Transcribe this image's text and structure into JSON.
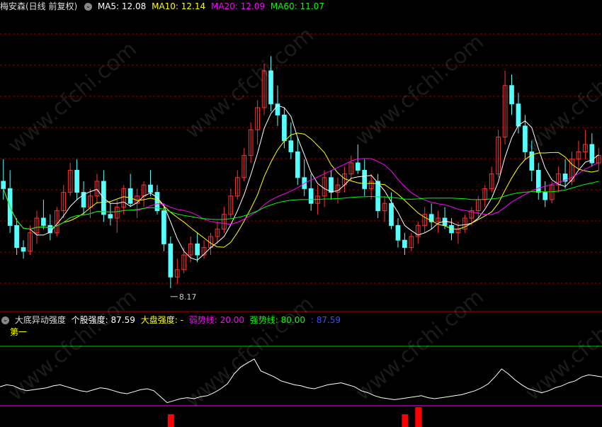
{
  "header": {
    "stock_title": "梅安森(日线 前复权)",
    "ma5": "MA5: 12.08",
    "ma10": "MA10: 12.14",
    "ma20": "MA20: 12.09",
    "ma60": "MA60: 11.07"
  },
  "indicator": {
    "name": "大底异动强度",
    "stock_strength": "个股强度: 87.59",
    "market_strength": "大盘强度: -",
    "weak_line": "弱势线: 20.00",
    "strong_line": "强势线: 80.00",
    "extra": ": 87.59",
    "first_label": "第一"
  },
  "watermark": "www.cfchi.com",
  "colors": {
    "up": "#ff3232",
    "down": "#54ffff",
    "ma5": "#ffffff",
    "ma10": "#ffff00",
    "ma20": "#ff00ff",
    "ma60": "#00ff00",
    "grid": "#8b0000",
    "weak": "#ff00ff",
    "strong": "#00c800",
    "osc": "#ffffff",
    "bar": "#ff0000"
  },
  "chart_data": {
    "type": "candlestick",
    "low_label": "8.17",
    "y_range": [
      7.5,
      15.5
    ],
    "candles_note": "daily OHLC approx",
    "ohlc": [
      [
        11.0,
        11.6,
        10.5,
        10.8
      ],
      [
        10.8,
        11.3,
        9.6,
        9.8
      ],
      [
        9.8,
        10.0,
        9.0,
        9.2
      ],
      [
        9.2,
        9.4,
        8.9,
        9.1
      ],
      [
        9.1,
        9.8,
        9.0,
        9.6
      ],
      [
        9.6,
        10.2,
        9.3,
        10.0
      ],
      [
        10.0,
        10.5,
        9.7,
        9.8
      ],
      [
        9.8,
        10.1,
        9.4,
        9.6
      ],
      [
        9.6,
        10.3,
        9.5,
        10.2
      ],
      [
        10.2,
        10.9,
        10.0,
        10.7
      ],
      [
        10.7,
        11.5,
        10.6,
        11.3
      ],
      [
        11.3,
        11.6,
        10.5,
        10.7
      ],
      [
        10.7,
        11.0,
        10.1,
        10.3
      ],
      [
        10.3,
        10.8,
        10.0,
        10.6
      ],
      [
        10.6,
        11.2,
        10.4,
        11.0
      ],
      [
        11.0,
        11.3,
        9.9,
        10.1
      ],
      [
        10.1,
        10.4,
        9.8,
        10.0
      ],
      [
        10.0,
        10.5,
        9.6,
        10.3
      ],
      [
        10.3,
        10.9,
        10.1,
        10.8
      ],
      [
        10.8,
        11.2,
        10.3,
        10.4
      ],
      [
        10.4,
        10.8,
        10.0,
        10.6
      ],
      [
        10.6,
        11.0,
        10.3,
        10.9
      ],
      [
        10.9,
        11.3,
        10.6,
        10.7
      ],
      [
        10.7,
        10.9,
        10.1,
        10.2
      ],
      [
        10.2,
        10.4,
        9.1,
        9.3
      ],
      [
        9.3,
        9.5,
        8.1,
        8.4
      ],
      [
        8.4,
        8.9,
        8.2,
        8.6
      ],
      [
        8.6,
        9.2,
        8.5,
        9.0
      ],
      [
        9.0,
        9.5,
        8.8,
        9.3
      ],
      [
        9.3,
        9.6,
        8.8,
        9.0
      ],
      [
        9.0,
        9.4,
        8.9,
        9.2
      ],
      [
        9.2,
        9.6,
        9.0,
        9.5
      ],
      [
        9.5,
        9.9,
        9.3,
        9.7
      ],
      [
        9.7,
        10.3,
        9.6,
        10.1
      ],
      [
        10.1,
        10.8,
        10.0,
        10.6
      ],
      [
        10.6,
        11.3,
        10.5,
        11.1
      ],
      [
        11.1,
        11.9,
        11.0,
        11.7
      ],
      [
        11.7,
        12.6,
        11.5,
        12.4
      ],
      [
        12.4,
        13.2,
        12.0,
        13.0
      ],
      [
        13.0,
        14.2,
        12.8,
        14.0
      ],
      [
        14.0,
        14.4,
        12.9,
        13.1
      ],
      [
        13.1,
        13.6,
        12.5,
        12.8
      ],
      [
        12.8,
        13.0,
        11.9,
        12.1
      ],
      [
        12.1,
        12.6,
        11.6,
        11.8
      ],
      [
        11.8,
        12.2,
        10.9,
        11.1
      ],
      [
        11.1,
        11.6,
        10.6,
        10.8
      ],
      [
        10.8,
        11.2,
        10.2,
        10.4
      ],
      [
        10.4,
        10.9,
        10.1,
        10.6
      ],
      [
        10.6,
        11.3,
        10.3,
        11.1
      ],
      [
        11.1,
        11.3,
        10.5,
        10.7
      ],
      [
        10.7,
        11.1,
        10.4,
        10.9
      ],
      [
        10.9,
        11.4,
        10.7,
        11.2
      ],
      [
        11.2,
        11.7,
        11.0,
        11.5
      ],
      [
        11.5,
        12.0,
        11.2,
        11.3
      ],
      [
        11.3,
        11.6,
        10.6,
        10.8
      ],
      [
        10.8,
        11.2,
        10.5,
        11.0
      ],
      [
        11.0,
        11.2,
        10.0,
        10.2
      ],
      [
        10.2,
        10.6,
        9.9,
        10.4
      ],
      [
        10.4,
        10.7,
        9.7,
        9.8
      ],
      [
        9.8,
        10.0,
        9.2,
        9.4
      ],
      [
        9.4,
        9.6,
        9.0,
        9.2
      ],
      [
        9.2,
        9.6,
        9.1,
        9.5
      ],
      [
        9.5,
        9.9,
        9.3,
        9.8
      ],
      [
        9.8,
        10.3,
        9.6,
        10.1
      ],
      [
        10.1,
        10.4,
        9.7,
        9.9
      ],
      [
        9.9,
        10.2,
        9.6,
        10.0
      ],
      [
        10.0,
        10.3,
        9.7,
        9.8
      ],
      [
        9.8,
        10.0,
        9.4,
        9.6
      ],
      [
        9.6,
        9.9,
        9.3,
        9.7
      ],
      [
        9.7,
        10.1,
        9.6,
        10.0
      ],
      [
        10.0,
        10.3,
        9.8,
        10.2
      ],
      [
        10.2,
        10.6,
        10.0,
        10.5
      ],
      [
        10.5,
        10.9,
        10.3,
        10.8
      ],
      [
        10.8,
        11.4,
        10.7,
        11.2
      ],
      [
        11.2,
        12.4,
        11.1,
        12.2
      ],
      [
        12.2,
        14.0,
        12.0,
        13.6
      ],
      [
        13.6,
        13.9,
        12.8,
        13.1
      ],
      [
        13.1,
        13.4,
        12.3,
        12.5
      ],
      [
        12.5,
        12.8,
        11.6,
        11.8
      ],
      [
        11.8,
        12.1,
        11.0,
        11.3
      ],
      [
        11.3,
        11.5,
        10.5,
        10.7
      ],
      [
        10.7,
        11.0,
        10.3,
        10.5
      ],
      [
        10.5,
        11.0,
        10.4,
        10.9
      ],
      [
        10.9,
        11.4,
        10.7,
        11.2
      ],
      [
        11.2,
        11.6,
        10.8,
        11.0
      ],
      [
        11.0,
        11.8,
        10.9,
        11.6
      ],
      [
        11.6,
        12.1,
        11.3,
        11.8
      ],
      [
        11.8,
        12.4,
        11.6,
        12.0
      ],
      [
        12.0,
        12.3,
        11.4,
        11.5
      ],
      [
        11.5,
        11.9,
        11.3,
        11.7
      ]
    ],
    "oscillator": [
      42,
      44,
      43,
      40,
      38,
      39,
      40,
      41,
      43,
      44,
      42,
      40,
      38,
      37,
      39,
      41,
      40,
      38,
      36,
      35,
      37,
      39,
      40,
      38,
      32,
      26,
      28,
      30,
      31,
      30,
      32,
      33,
      36,
      40,
      45,
      55,
      62,
      66,
      70,
      58,
      55,
      52,
      48,
      46,
      44,
      43,
      41,
      40,
      42,
      44,
      45,
      46,
      44,
      42,
      38,
      36,
      33,
      31,
      30,
      29,
      30,
      31,
      32,
      33,
      31,
      30,
      31,
      32,
      33,
      34,
      36,
      38,
      41,
      45,
      52,
      60,
      55,
      49,
      44,
      40,
      38,
      36,
      38,
      41,
      43,
      46,
      48,
      52,
      54,
      53,
      52
    ],
    "bars": [
      {
        "i": 25,
        "h": 18
      },
      {
        "i": 60,
        "h": 18
      },
      {
        "i": 62,
        "h": 28
      }
    ]
  }
}
